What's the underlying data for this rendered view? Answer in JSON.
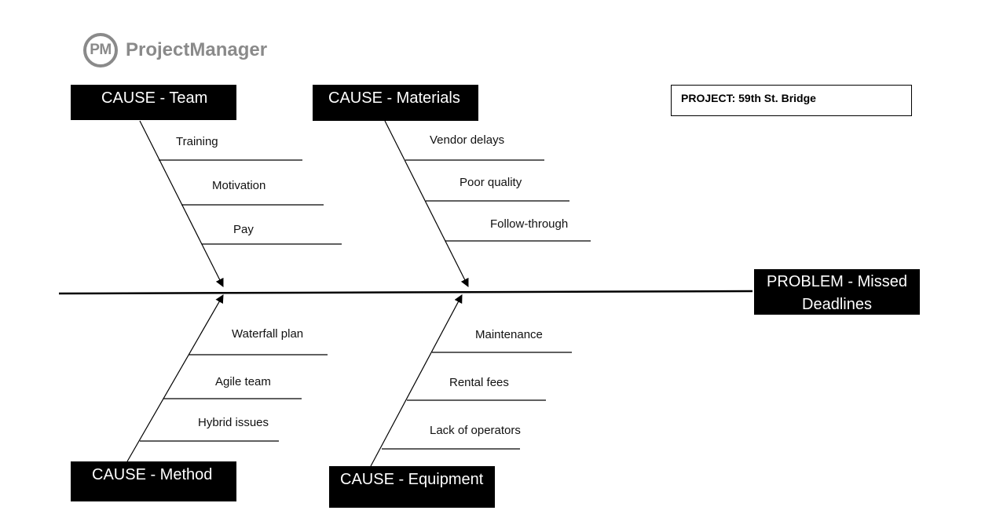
{
  "logo": {
    "icon_text": "PM",
    "brand": "ProjectManager"
  },
  "project": {
    "label": "PROJECT: 59th St. Bridge"
  },
  "problem": {
    "line1": "PROBLEM - Missed",
    "line2": "Deadlines"
  },
  "causes": {
    "team": {
      "title": "CAUSE - Team",
      "items": [
        "Training",
        "Motivation",
        "Pay"
      ]
    },
    "materials": {
      "title": "CAUSE - Materials",
      "items": [
        "Vendor delays",
        "Poor quality",
        "Follow-through"
      ]
    },
    "method": {
      "title": "CAUSE - Method",
      "items": [
        "Waterfall plan",
        "Agile team",
        "Hybrid issues"
      ]
    },
    "equipment": {
      "title": "CAUSE - Equipment",
      "items": [
        "Maintenance",
        "Rental fees",
        "Lack of operators"
      ]
    }
  },
  "colors": {
    "box_fill": "#000000",
    "box_text": "#ffffff",
    "logo_gray": "#8a8a8a",
    "line": "#000000"
  }
}
